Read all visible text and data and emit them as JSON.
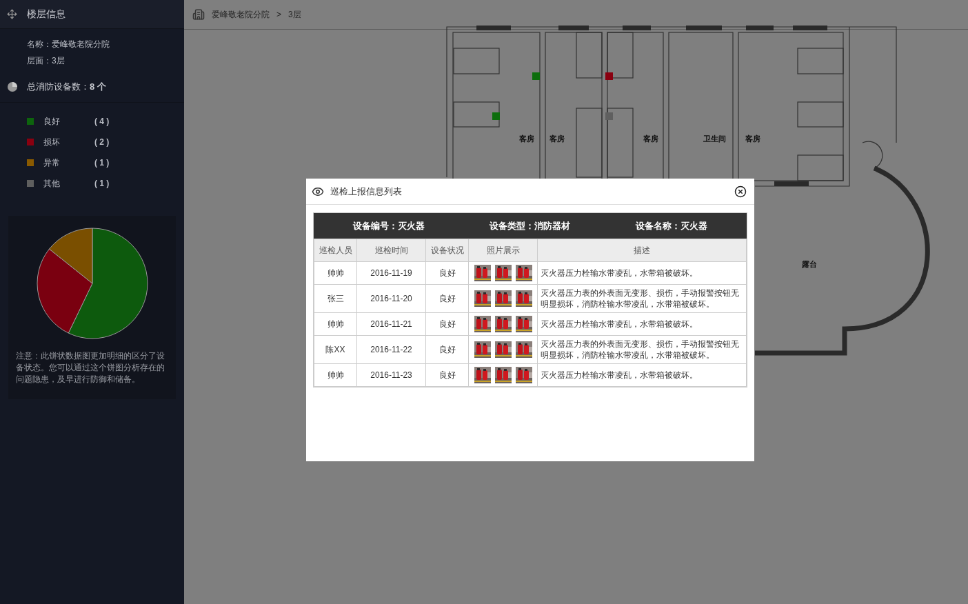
{
  "sidebar": {
    "title": "楼层信息",
    "info": [
      "名称：爱峰敬老院分院",
      "层面：3层"
    ],
    "total": {
      "label": "总消防设备数：",
      "value": "8 个"
    },
    "legend": [
      {
        "label": "良好",
        "count": "( 4 )",
        "color": "#0d640d"
      },
      {
        "label": "损坏",
        "count": "( 2 )",
        "color": "#8a0010"
      },
      {
        "label": "异常",
        "count": "( 1 )",
        "color": "#8a5a00"
      },
      {
        "label": "其他",
        "count": "( 1 )",
        "color": "#5f5f5f"
      }
    ],
    "pie": {
      "kind": "picture"
    },
    "note": "注意：此饼状数据图更加明细的区分了设备状态。您可以通过这个饼图分析存在的问题隐患，及早进行防御和储备。"
  },
  "breadcrumb": [
    {
      "label": "爱峰敬老院分院"
    },
    {
      "label": "3层"
    }
  ],
  "breadcrumb_separator": ">",
  "plan": {
    "rooms": [
      "客房",
      "客房",
      "客房",
      "卫生间",
      "客房"
    ],
    "terrace": "露台",
    "devices": [
      {
        "color": "#0d6e0d"
      },
      {
        "color": "#0d6e0d"
      },
      {
        "color": "#8a0010"
      },
      {
        "color": "#5f5f5f"
      }
    ]
  },
  "modal": {
    "title": "巡检上报信息列表",
    "summary": [
      "设备编号：灭火器",
      "设备类型：消防器材",
      "设备名称：灭火器"
    ],
    "columns": [
      "巡检人员",
      "巡检时间",
      "设备状况",
      "照片展示",
      "描述"
    ],
    "rows": [
      {
        "person": "帅帅",
        "time": "2016-11-19",
        "status": "良好",
        "photos": [
          {
            "kind": "picture"
          },
          {
            "kind": "picture"
          },
          {
            "kind": "picture"
          }
        ],
        "desc": "灭火器压力栓输水带凌乱，水带箱被破坏。"
      },
      {
        "person": "张三",
        "time": "2016-11-20",
        "status": "良好",
        "photos": [
          {
            "kind": "picture"
          },
          {
            "kind": "picture"
          },
          {
            "kind": "picture"
          }
        ],
        "desc": "灭火器压力表的外表面无变形、损伤，手动报警按钮无明显损坏，消防栓输水带凌乱，水带箱被破坏。"
      },
      {
        "person": "帅帅",
        "time": "2016-11-21",
        "status": "良好",
        "photos": [
          {
            "kind": "picture"
          },
          {
            "kind": "picture"
          },
          {
            "kind": "picture"
          }
        ],
        "desc": "灭火器压力栓输水带凌乱，水带箱被破坏。"
      },
      {
        "person": "陈XX",
        "time": "2016-11-22",
        "status": "良好",
        "photos": [
          {
            "kind": "picture"
          },
          {
            "kind": "picture"
          },
          {
            "kind": "picture"
          }
        ],
        "desc": "灭火器压力表的外表面无变形、损伤，手动报警按钮无明显损坏，消防栓输水带凌乱，水带箱被破坏。"
      },
      {
        "person": "帅帅",
        "time": "2016-11-23",
        "status": "良好",
        "photos": [
          {
            "kind": "picture"
          },
          {
            "kind": "picture"
          },
          {
            "kind": "picture"
          }
        ],
        "desc": "灭火器压力栓输水带凌乱，水带箱被破坏。"
      }
    ]
  }
}
